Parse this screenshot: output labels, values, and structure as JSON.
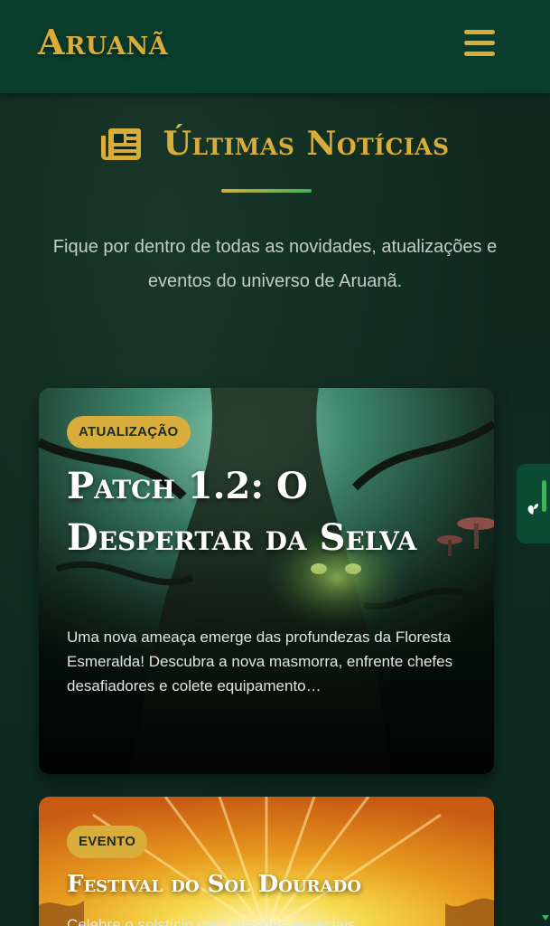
{
  "header": {
    "logo": "Aruanã",
    "menu_icon": "hamburger-menu-icon"
  },
  "section": {
    "icon": "newspaper-icon",
    "title": "Últimas Notícias",
    "subtitle": "Fique por dentro de todas as novidades, atualizações e eventos do universo de Aruanã."
  },
  "colors": {
    "accent_gold": "#d8ad3a",
    "accent_green": "#3fb35a",
    "header_bg": "#0b3d2c",
    "page_bg": "#0f2a21"
  },
  "cards": [
    {
      "badge": "ATUALIZAÇÃO",
      "title": "Patch 1.2: O Despertar da Selva",
      "excerpt": "Uma nova ameaça emerge das profundezas da Floresta Esmeralda! Descubra a nova masmorra, enfrente chefes desafiadores e colete equipamento…",
      "image": "dark-jungle-tree-image"
    },
    {
      "badge": "EVENTO",
      "title": "Festival do Sol Dourado",
      "excerpt": "Celebre o solstício com missões especiais",
      "image": "golden-sun-rays-image"
    }
  ],
  "side_tab": {
    "icon": "leaf-icon"
  }
}
